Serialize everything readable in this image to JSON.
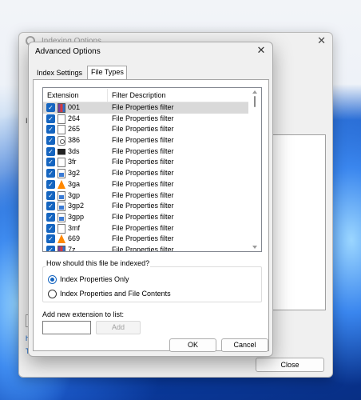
{
  "background_window": {
    "title": "Indexing Options",
    "label_i": "I",
    "link1": "h",
    "link2": "T",
    "close_button": "Close"
  },
  "dialog": {
    "title": "Advanced Options",
    "close_glyph": "✕"
  },
  "tabs": [
    {
      "label": "Index Settings",
      "active": false
    },
    {
      "label": "File Types",
      "active": true
    }
  ],
  "list": {
    "header_extension": "Extension",
    "header_description": "Filter Description",
    "rows": [
      {
        "ext": "001",
        "desc": "File Properties filter",
        "icon": "rar-archive-icon",
        "checked": true,
        "selected": true
      },
      {
        "ext": "264",
        "desc": "File Properties filter",
        "icon": "document-icon",
        "checked": true,
        "selected": false
      },
      {
        "ext": "265",
        "desc": "File Properties filter",
        "icon": "document-icon",
        "checked": true,
        "selected": false
      },
      {
        "ext": "386",
        "desc": "File Properties filter",
        "icon": "gear-document-icon",
        "checked": true,
        "selected": false
      },
      {
        "ext": "3ds",
        "desc": "File Properties filter",
        "icon": "3d-model-icon",
        "checked": true,
        "selected": false
      },
      {
        "ext": "3fr",
        "desc": "File Properties filter",
        "icon": "document-icon",
        "checked": true,
        "selected": false
      },
      {
        "ext": "3g2",
        "desc": "File Properties filter",
        "icon": "video-file-icon",
        "checked": true,
        "selected": false
      },
      {
        "ext": "3ga",
        "desc": "File Properties filter",
        "icon": "vlc-cone-icon",
        "checked": true,
        "selected": false
      },
      {
        "ext": "3gp",
        "desc": "File Properties filter",
        "icon": "video-file-icon",
        "checked": true,
        "selected": false
      },
      {
        "ext": "3gp2",
        "desc": "File Properties filter",
        "icon": "video-file-icon",
        "checked": true,
        "selected": false
      },
      {
        "ext": "3gpp",
        "desc": "File Properties filter",
        "icon": "video-file-icon",
        "checked": true,
        "selected": false
      },
      {
        "ext": "3mf",
        "desc": "File Properties filter",
        "icon": "document-icon",
        "checked": true,
        "selected": false
      },
      {
        "ext": "669",
        "desc": "File Properties filter",
        "icon": "vlc-cone-icon",
        "checked": true,
        "selected": false
      },
      {
        "ext": "7z",
        "desc": "File Properties filter",
        "icon": "rar-archive-icon",
        "checked": true,
        "selected": false
      }
    ]
  },
  "index_group": {
    "label": "How should this file be indexed?",
    "option1": "Index Properties Only",
    "option2": "Index Properties and File Contents",
    "selected": 1
  },
  "add_extension": {
    "label": "Add new extension to list:",
    "value": "",
    "button": "Add"
  },
  "buttons": {
    "ok": "OK",
    "cancel": "Cancel"
  },
  "colors": {
    "accent": "#1565c0"
  }
}
